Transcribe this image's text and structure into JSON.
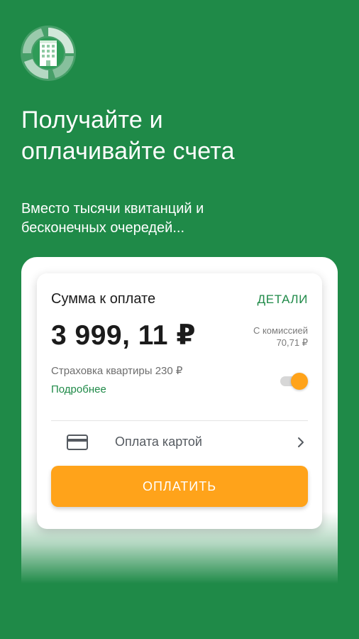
{
  "headline": {
    "line1": "Получайте и",
    "line2": "оплачивайте счета"
  },
  "subtitle": {
    "line1": "Вместо тысячи квитанций и",
    "line2": "бесконечных очередей..."
  },
  "payment_card": {
    "title": "Сумма к оплате",
    "details_link": "ДЕТАЛИ",
    "amount": "3 999, 11 ₽",
    "commission_label": "С комиссией",
    "commission_value": "70,71 ₽",
    "insurance_text": "Страховка квартиры 230 ₽",
    "more_link": "Подробнее",
    "insurance_toggle_on": true,
    "payment_method_label": "Оплата картой",
    "pay_button_label": "ОПЛАТИТЬ"
  },
  "icons": {
    "logo": "building-logo-icon",
    "payment_method": "credit-card-icon",
    "payment_chevron": "chevron-right-icon"
  },
  "colors": {
    "background": "#1f8a48",
    "accent": "#ffa31a",
    "link": "#1f8a48",
    "text": "#1b1b1b",
    "muted_text": "#7a7a7a"
  }
}
